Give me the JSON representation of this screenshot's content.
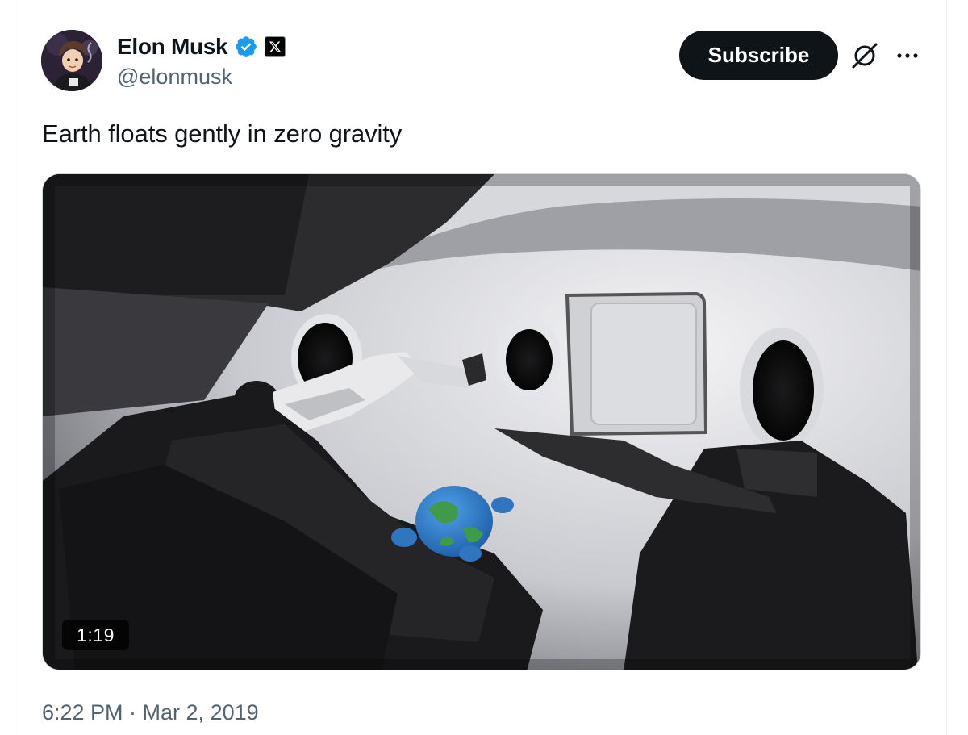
{
  "author": {
    "display_name": "Elon Musk",
    "handle": "@elonmusk",
    "avatar_icon": "profile-avatar",
    "verified_icon": "verified-badge-icon",
    "affiliation_icon": "x-logo-icon"
  },
  "actions": {
    "subscribe_label": "Subscribe",
    "grok_icon": "grok-icon",
    "more_icon": "more-options-icon"
  },
  "tweet": {
    "text": "Earth floats gently in zero gravity",
    "video_duration": "1:19",
    "timestamp": "6:22 PM · Mar 2, 2019"
  },
  "colors": {
    "text_primary": "#0f1419",
    "text_secondary": "#536471",
    "verified_blue": "#1d9bf0",
    "button_bg": "#0f1419"
  }
}
